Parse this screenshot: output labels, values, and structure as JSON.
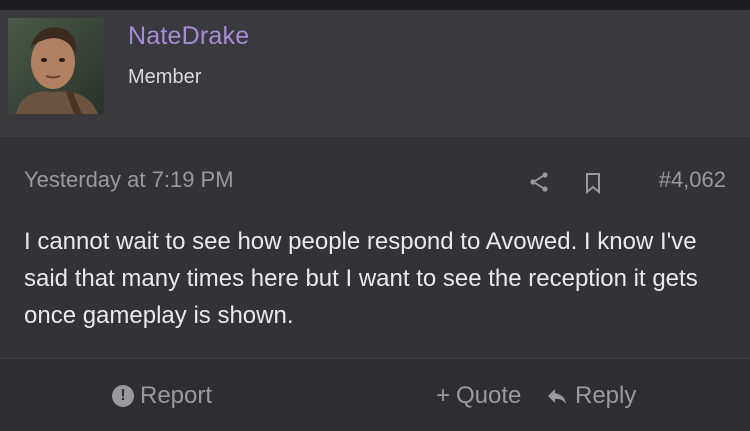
{
  "user": {
    "name": "NateDrake",
    "title": "Member"
  },
  "post": {
    "date": "Yesterday at 7:19 PM",
    "number": "#4,062",
    "text": "I cannot wait to see how people respond to Avowed. I know I've said that many times here but I want to see the reception it gets once gameplay is shown."
  },
  "actions": {
    "report": "Report",
    "quote": "Quote",
    "reply": "Reply"
  },
  "colors": {
    "username": "#a78bd6",
    "header_bg": "#3a3a3e",
    "body_bg": "#333336",
    "muted_text": "#9a9a9e",
    "text": "#e9e9eb"
  },
  "icons": {
    "share": "share-icon",
    "bookmark": "bookmark-icon",
    "report": "exclamation-circle-icon",
    "quote": "plus-icon",
    "reply": "reply-arrow-icon"
  }
}
